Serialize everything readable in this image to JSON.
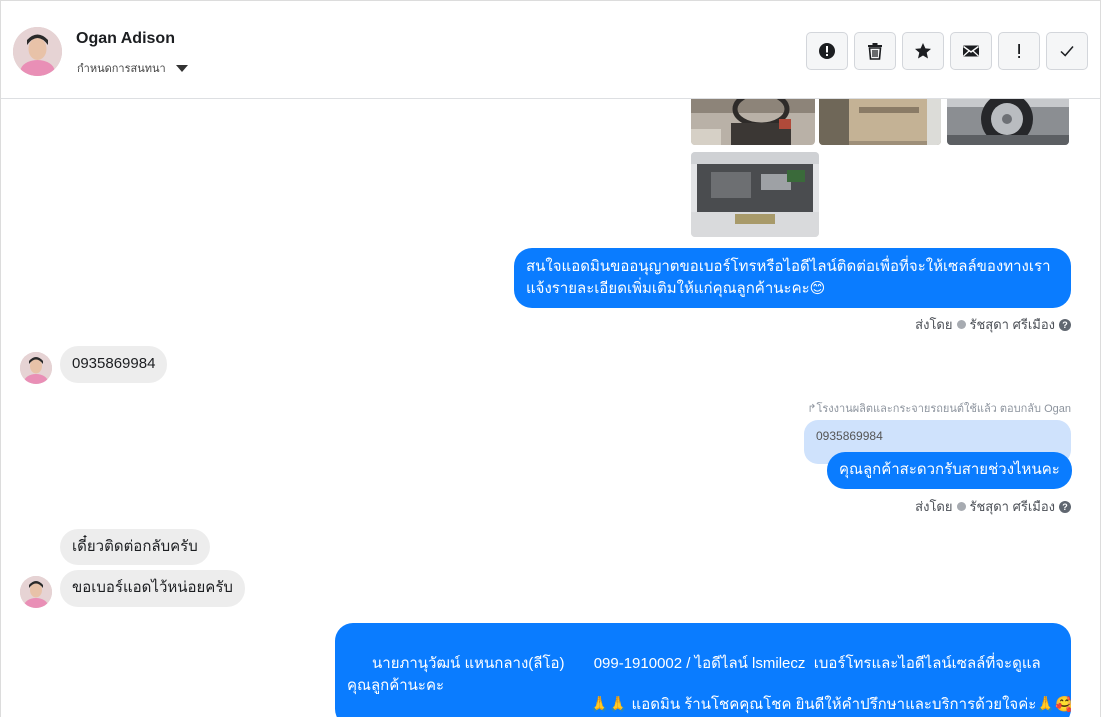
{
  "header": {
    "contact_name": "Ogan Adison",
    "conversation_setting": "กำหนดการสนทนา",
    "actions": [
      {
        "icon": "alert-circle-icon",
        "name": "mark-spam-button"
      },
      {
        "icon": "trash-icon",
        "name": "delete-button"
      },
      {
        "icon": "star-icon",
        "name": "star-button"
      },
      {
        "icon": "envelope-icon",
        "name": "mark-unread-button"
      },
      {
        "icon": "exclamation-icon",
        "name": "flag-button"
      },
      {
        "icon": "check-icon",
        "name": "mark-done-button"
      }
    ]
  },
  "messages": {
    "out_1": "สนใจแอดมินขออนุญาตขอเบอร์โทรหรือไอดีไลน์ติดต่อเพื่อที่จะให้เซลล์ของทางเรา แจ้งรายละเอียดเพิ่มเติมให้แก่คุณลูกค้านะคะ😊",
    "sent_by_label": "ส่งโดย",
    "sender_name": "รัชสุดา ศรีเมือง",
    "in_1": "0935869984",
    "reply_note": "↱โรงงานผลิตและกระจายรถยนต์ใช้แล้ว ตอบกลับ Ogan",
    "quoted": "0935869984",
    "out_2": "คุณลูกค้าสะดวกรับสายช่วงไหนคะ",
    "in_2": "เดี๋ยวติดต่อกลับครับ",
    "in_3": "ขอเบอร์แอดไว้หน่อยครับ",
    "out_3": "นายภานุวัฒน์ แหนกลาง(ลีโอ)       099-1910002 / ไอดีไลน์ lsmilecz  เบอร์โทรและไอดีไลน์เซลล์ที่จะดูแลคุณลูกค้านะคะ",
    "out_4": "🙏🙏 แอดมิน ร้านโชคคุณโชค ยินดีให้คำปรึกษาและบริการด้วยใจค่ะ🙏🥰"
  },
  "colors": {
    "outgoing_bubble": "#0a7cff",
    "incoming_bubble": "#ededed",
    "quote_bubble": "#cfe2fc"
  }
}
